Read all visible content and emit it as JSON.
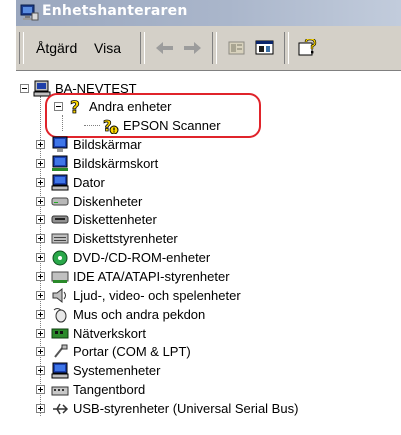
{
  "window": {
    "title": "Enhetshanteraren"
  },
  "menu": {
    "action_label": "Åtgärd",
    "view_label": "Visa"
  },
  "toolbar": {
    "buttons": [
      "back-arrow-icon",
      "forward-arrow-icon",
      "folder-tree-icon",
      "properties-icon",
      "help-icon"
    ]
  },
  "tree": {
    "root": "BA-NEVTEST",
    "other_devices": "Andra enheter",
    "epson": "EPSON Scanner",
    "items": [
      "Bildskärmar",
      "Bildskärmskort",
      "Dator",
      "Diskenheter",
      "Diskettenheter",
      "Diskettstyrenheter",
      "DVD-/CD-ROM-enheter",
      "IDE ATA/ATAPI-styrenheter",
      "Ljud-, video- och spelenheter",
      "Mus och andra pekdon",
      "Nätverkskort",
      "Portar (COM & LPT)",
      "Systemenheter",
      "Tangentbord",
      "USB-styrenheter (Universal Serial Bus)"
    ]
  },
  "colors": {
    "highlight": "#e0242b",
    "titlebar": "#9aa7be",
    "toolbar": "#d4d0c8"
  }
}
